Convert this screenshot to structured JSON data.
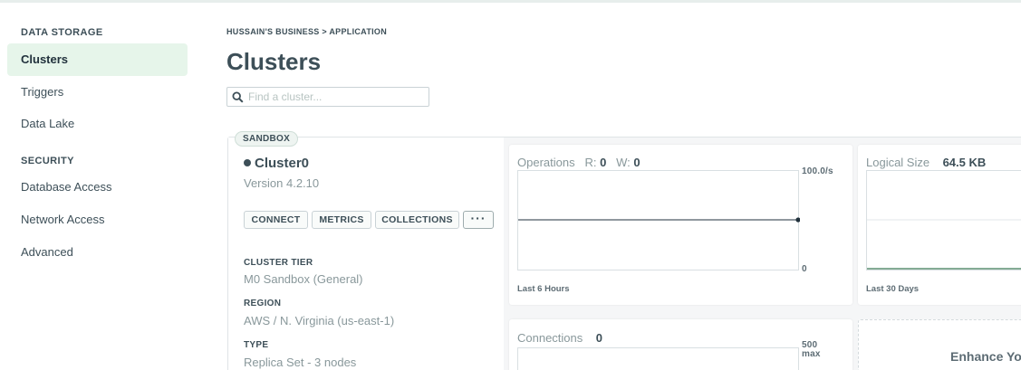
{
  "sidebar": {
    "sections": [
      {
        "title": "DATA STORAGE",
        "items": [
          "Clusters",
          "Triggers",
          "Data Lake"
        ]
      },
      {
        "title": "SECURITY",
        "items": [
          "Database Access",
          "Network Access",
          "Advanced"
        ]
      }
    ],
    "active_item": "Clusters"
  },
  "header": {
    "breadcrumb": "HUSSAIN'S BUSINESS > APPLICATION",
    "title": "Clusters"
  },
  "search": {
    "placeholder": "Find a cluster...",
    "icon": "search-icon"
  },
  "cluster": {
    "badge": "SANDBOX",
    "name": "Cluster0",
    "version": "Version 4.2.10",
    "buttons": {
      "connect": "CONNECT",
      "metrics": "METRICS",
      "collections": "COLLECTIONS",
      "more": "···"
    },
    "attributes": [
      {
        "label": "CLUSTER TIER",
        "value": "M0 Sandbox (General)"
      },
      {
        "label": "REGION",
        "value": "AWS / N. Virginia (us-east-1)"
      },
      {
        "label": "TYPE",
        "value": "Replica Set - 3 nodes"
      }
    ]
  },
  "metrics": {
    "operations": {
      "title": "Operations",
      "r_label": "R:",
      "r_value": "0",
      "w_label": "W:",
      "w_value": "0",
      "max_label": "100.0/s",
      "min_label": "0",
      "footer": "Last 6 Hours",
      "level": 0.5
    },
    "logical_size": {
      "title": "Logical Size",
      "value": "64.5 KB",
      "footer": "Last 30 Days",
      "level": 0.0
    },
    "connections": {
      "title": "Connections",
      "value": "0",
      "max_value": "500",
      "max_unit": "max"
    },
    "enhance_text": "Enhance Yo"
  },
  "colors": {
    "active_bg": "#e6f5ea",
    "text": "#3d4f58",
    "muted": "#89989b",
    "chart_line": "#21313c",
    "size_line": "#13aa52"
  }
}
